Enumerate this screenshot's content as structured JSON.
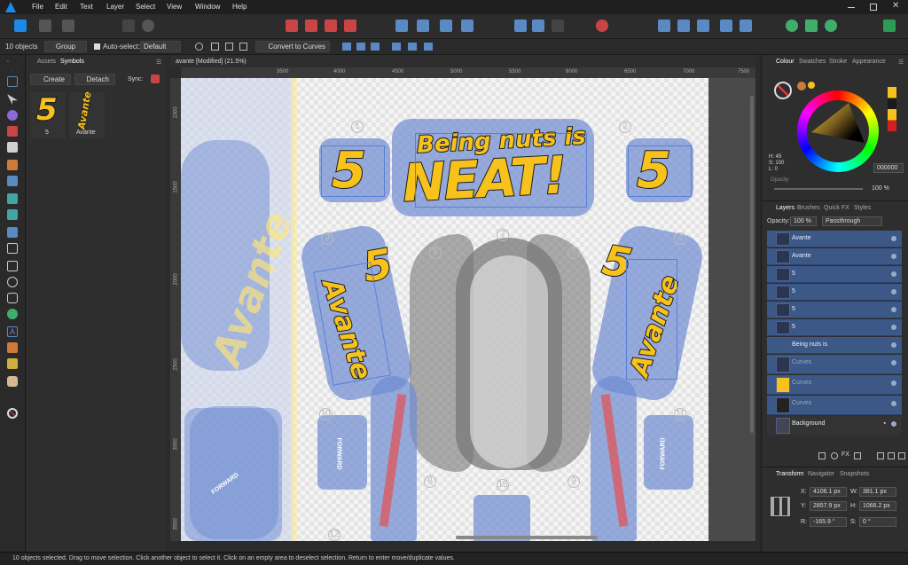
{
  "app": {
    "logo": "affinity-designer-logo",
    "menu": [
      "File",
      "Edit",
      "Text",
      "Layer",
      "Select",
      "View",
      "Window",
      "Help"
    ]
  },
  "context": {
    "selection_count": "10 objects",
    "group_label": "Group",
    "auto_select_label": "Auto-select:",
    "auto_select_value": "Default",
    "convert_label": "Convert to Curves"
  },
  "left_panel": {
    "tabs": [
      "Assets",
      "Symbols"
    ],
    "create_label": "Create",
    "detach_label": "Detach",
    "sync_label": "Sync:",
    "symbols": [
      {
        "glyph": "5",
        "label": "5"
      },
      {
        "glyph": "Avante",
        "label": "Avante"
      }
    ]
  },
  "document": {
    "tab_title": "avante [Modified] (21.5%)",
    "ruler_ticks": [
      "3500",
      "4000",
      "4500",
      "5000",
      "5500",
      "6000",
      "6500",
      "7000",
      "7500"
    ],
    "ruler_v_ticks": [
      "1000",
      "1500",
      "2000",
      "2500",
      "3000",
      "3500"
    ]
  },
  "artwork": {
    "headline_top": "Being nuts is",
    "headline_bottom": "NEAT!",
    "number": "5",
    "brand": "Avante",
    "piece_numbers": [
      "1",
      "2",
      "3",
      "4",
      "5",
      "6",
      "7",
      "8",
      "9",
      "10",
      "11",
      "12",
      "15"
    ],
    "forward_label": "FORWARD"
  },
  "right_panel": {
    "colour_tabs": [
      "Colour",
      "Swatches",
      "Stroke",
      "Appearance"
    ],
    "hsl": {
      "h": "H: 45",
      "s": "S: 100",
      "l": "L: 0"
    },
    "hex": "000000",
    "opacity_label": "Opacity",
    "opacity_value": "100 %",
    "layer_tabs": [
      "Layers",
      "Brushes",
      "Quick FX",
      "Styles"
    ],
    "layer_opacity_label": "Opacity:",
    "layer_opacity": "100 %",
    "blend_mode": "Passthrough",
    "layers": [
      "Avante",
      "Avante",
      "5",
      "5",
      "5",
      "5",
      "Being nuts is",
      "Curves",
      "Curves",
      "Curves",
      "Background"
    ],
    "transform_tabs": [
      "Transform",
      "Navigator",
      "Snapshots"
    ],
    "transform": {
      "x_label": "X:",
      "x": "4106.1 px",
      "w_label": "W:",
      "w": "381.1 px",
      "y_label": "Y:",
      "y": "2857.9 px",
      "h_label": "H:",
      "h": "1066.2 px",
      "r_label": "R:",
      "r": "-165.9 °",
      "s_label": "S:",
      "s": "0 °"
    }
  },
  "status": {
    "text": "10 objects selected. Drag to move selection. Click another object to select it. Click on an empty area to deselect selection. Return to enter move/duplicate values."
  },
  "colors": {
    "accent": "#f7c21c",
    "selection_blue": "#3c5886",
    "piece_blue": "#6e8cd2",
    "app_logo": "#1e88e5"
  }
}
